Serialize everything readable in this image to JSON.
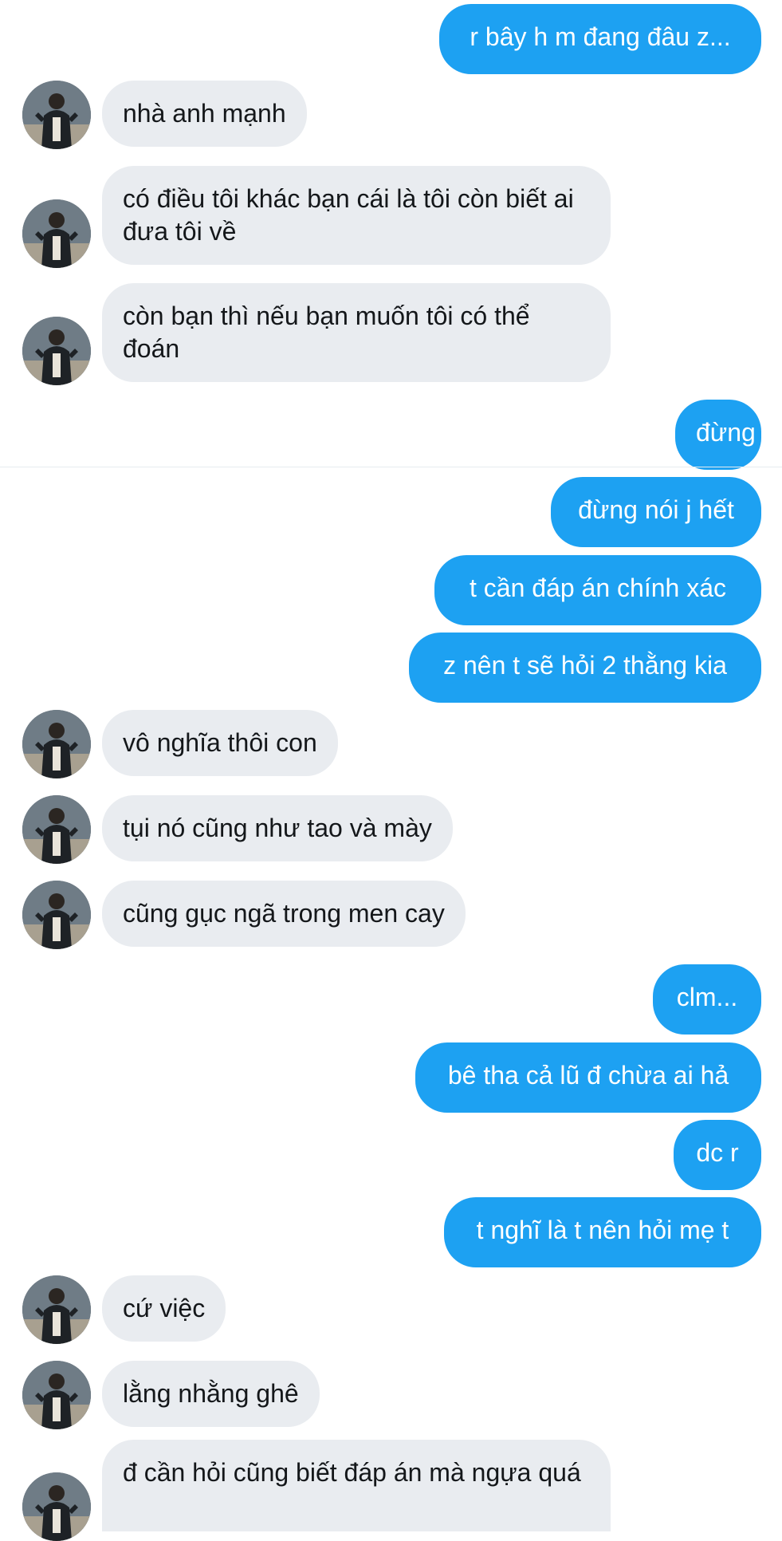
{
  "conversation": {
    "messages": [
      {
        "side": "out",
        "text": "r bây h m đang đâu z..."
      },
      {
        "side": "in",
        "text": "nhà anh mạnh"
      },
      {
        "side": "in",
        "text": "có điều tôi khác bạn cái là tôi còn biết ai đưa tôi về"
      },
      {
        "side": "in",
        "text": "còn bạn thì nếu bạn muốn tôi có thể đoán"
      },
      {
        "side": "out",
        "text": "đừng"
      },
      {
        "side": "out",
        "text": "đừng nói j hết"
      },
      {
        "side": "out",
        "text": "t cần đáp án chính xác"
      },
      {
        "side": "out",
        "text": "z nên t sẽ hỏi 2 thằng kia"
      },
      {
        "side": "in",
        "text": "vô nghĩa thôi con"
      },
      {
        "side": "in",
        "text": "tụi nó cũng như tao và mày"
      },
      {
        "side": "in",
        "text": "cũng gục ngã trong men cay"
      },
      {
        "side": "out",
        "text": "clm..."
      },
      {
        "side": "out",
        "text": "bê tha cả lũ đ chừa ai hả"
      },
      {
        "side": "out",
        "text": "dc r"
      },
      {
        "side": "out",
        "text": "t nghĩ là t nên hỏi mẹ t"
      },
      {
        "side": "in",
        "text": "cứ việc"
      },
      {
        "side": "in",
        "text": "lằng nhằng ghê"
      },
      {
        "side": "in",
        "text": "đ cần hỏi cũng biết đáp án mà ngựa quá"
      }
    ]
  },
  "colors": {
    "outgoing_bubble": "#1da1f2",
    "incoming_bubble": "#e9ecf0",
    "incoming_text": "#14171a",
    "outgoing_text": "#ffffff"
  },
  "icons": {
    "avatar": "user-avatar-photo"
  }
}
